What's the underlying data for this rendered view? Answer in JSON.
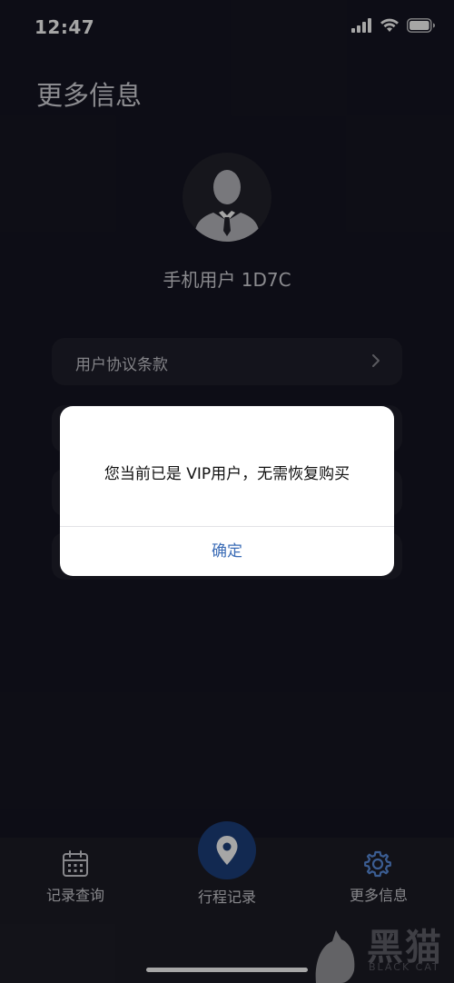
{
  "status_bar": {
    "time": "12:47"
  },
  "page": {
    "title": "更多信息"
  },
  "profile": {
    "username": "手机用户 1D7C"
  },
  "list": {
    "items": [
      {
        "label": "用户协议条款"
      }
    ]
  },
  "alert": {
    "message": "您当前已是 VIP用户，无需恢复购买",
    "confirm_label": "确定"
  },
  "tab_bar": {
    "tabs": [
      {
        "label": "记录查询",
        "icon": "calendar-icon"
      },
      {
        "label": "行程记录",
        "icon": "location-pin-icon"
      },
      {
        "label": "更多信息",
        "icon": "gear-icon"
      }
    ],
    "accent": "#1c3f7d"
  },
  "watermark": {
    "text": "黑猫",
    "sub": "BLACK CAT"
  },
  "colors": {
    "background": "#151522",
    "alert_button": "#3b6cb6"
  }
}
